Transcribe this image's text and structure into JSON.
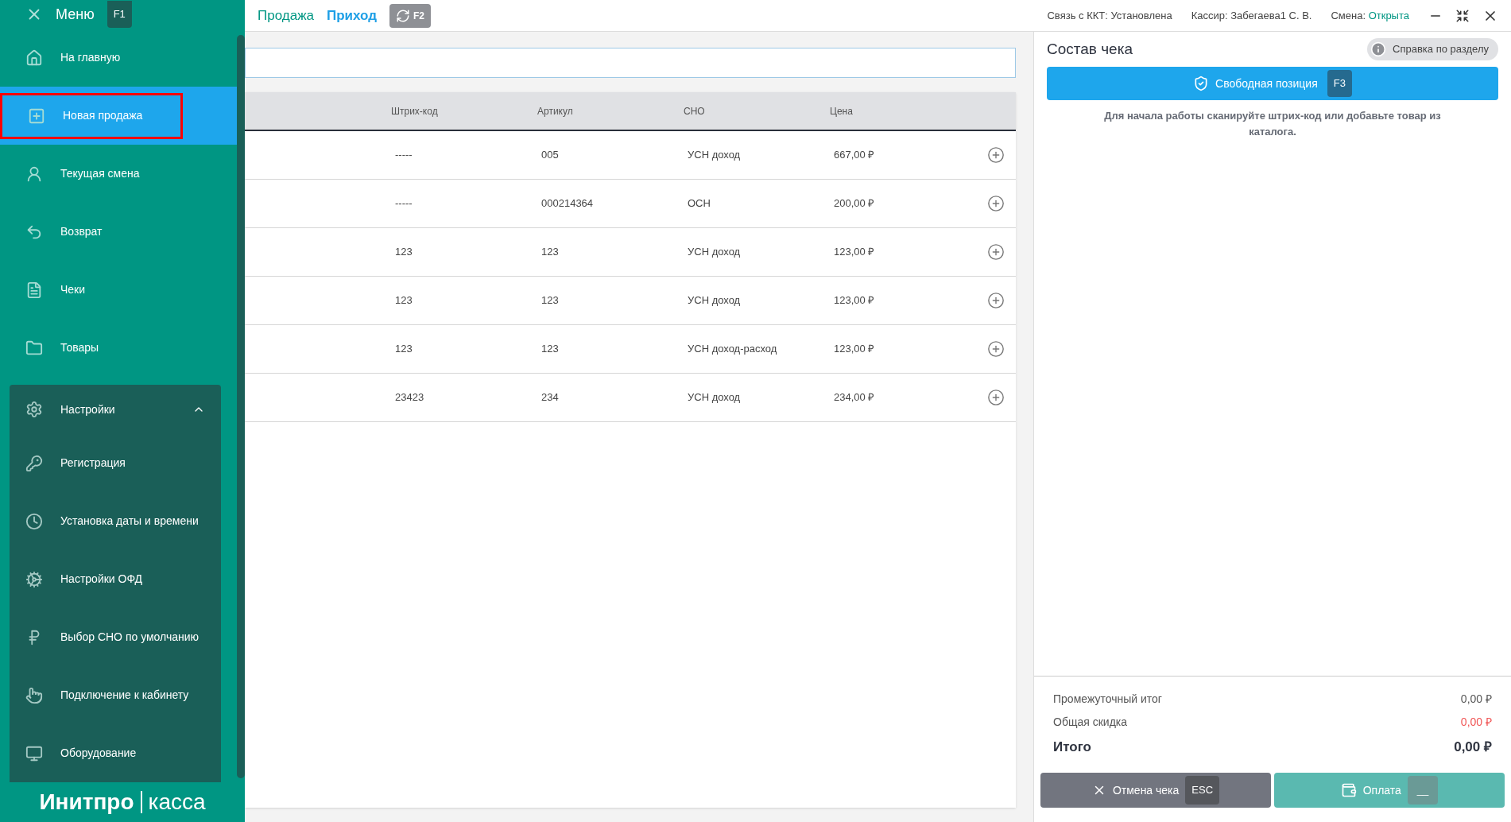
{
  "sidebar": {
    "title": "Меню",
    "shortcut": "F1",
    "items": [
      {
        "label": "На главную",
        "selected": false,
        "outlined": false
      },
      {
        "label": "Новая продажа",
        "selected": true,
        "outlined": true
      },
      {
        "label": "Текущая смена",
        "selected": false,
        "outlined": false
      },
      {
        "label": "Возврат",
        "selected": false,
        "outlined": false
      },
      {
        "label": "Чеки",
        "selected": false,
        "outlined": false
      },
      {
        "label": "Товары",
        "selected": false,
        "outlined": false
      }
    ],
    "settings": {
      "label": "Настройки",
      "expanded": true,
      "children": [
        {
          "label": "Регистрация"
        },
        {
          "label": "Установка даты и времени"
        },
        {
          "label": "Настройки ОФД"
        },
        {
          "label": "Выбор СНО по умолчанию"
        },
        {
          "label": "Подключение к кабинету"
        },
        {
          "label": "Оборудование"
        }
      ]
    },
    "logo": {
      "left": "Инитпро",
      "right": "касса"
    }
  },
  "topbar": {
    "tabs": [
      {
        "label": "Продажа",
        "selected": false
      },
      {
        "label": "Приход",
        "selected": true
      }
    ],
    "refresh_shortcut": "F2",
    "status": [
      {
        "label": "Связь с ККТ:",
        "value": "Установлена",
        "highlight": false
      },
      {
        "label": "Кассир:",
        "value": "Забегаева1 С. В.",
        "highlight": false
      },
      {
        "label": "Смена:",
        "value": "Открыта",
        "highlight": true
      }
    ]
  },
  "table": {
    "columns": [
      "Штрих-код",
      "Артикул",
      "СНО",
      "Цена"
    ],
    "rows": [
      [
        "-----",
        "005",
        "УСН доход",
        "667,00 ₽"
      ],
      [
        "-----",
        "000214364",
        "ОСН",
        "200,00 ₽"
      ],
      [
        "123",
        "123",
        "УСН доход",
        "123,00 ₽"
      ],
      [
        "123",
        "123",
        "УСН доход",
        "123,00 ₽"
      ],
      [
        "123",
        "123",
        "УСН доход-расход",
        "123,00 ₽"
      ],
      [
        "23423",
        "234",
        "УСН доход",
        "234,00 ₽"
      ]
    ]
  },
  "receipt": {
    "title": "Состав чека",
    "help": "Справка по разделу",
    "free_item": {
      "label": "Свободная позиция",
      "shortcut": "F3"
    },
    "hint": "Для начала работы сканируйте штрих-код или добавьте товар из каталога.",
    "totals": [
      {
        "label": "Промежуточный итог",
        "value": "0,00 ₽",
        "kind": "normal"
      },
      {
        "label": "Общая скидка",
        "value": "0,00 ₽",
        "kind": "discount"
      },
      {
        "label": "Итого",
        "value": "0,00 ₽",
        "kind": "total"
      }
    ],
    "cancel": {
      "label": "Отмена чека",
      "shortcut": "ESC"
    },
    "pay": {
      "label": "Оплата",
      "shortcut": "__"
    }
  }
}
